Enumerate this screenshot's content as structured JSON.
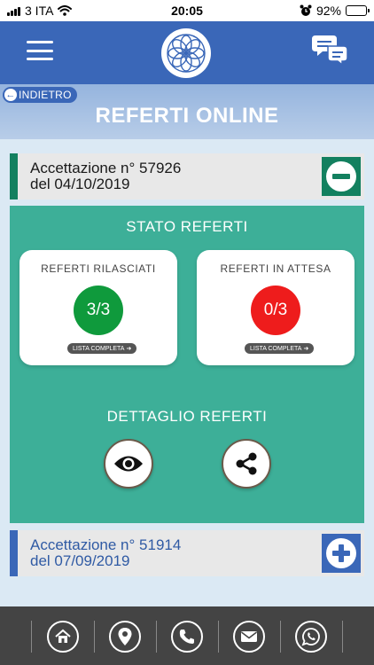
{
  "status_bar": {
    "carrier": "3 ITA",
    "time": "20:05",
    "battery": "92%",
    "battery_level": 0.92,
    "icons": [
      "signal-icon",
      "wifi-icon",
      "alarm-icon",
      "battery-icon"
    ]
  },
  "header": {
    "menu_icon": "hamburger-menu-icon",
    "logo_icon": "mandala-logo",
    "chat_icon": "chat-bubbles-icon"
  },
  "title_band": {
    "back_label": "INDIETRO",
    "title": "REFERTI ONLINE"
  },
  "accettazioni": [
    {
      "line1": "Accettazione n° 57926",
      "line2": "del 04/10/2019",
      "expanded": true,
      "toggle_icon": "minus-icon"
    },
    {
      "line1": "Accettazione n° 51914",
      "line2": "del 07/09/2019",
      "expanded": false,
      "toggle_icon": "plus-icon"
    }
  ],
  "stato": {
    "title": "STATO REFERTI",
    "rilasciati": {
      "label": "REFERTI RILASCIATI",
      "value": "3/3",
      "link": "LISTA COMPLETA"
    },
    "in_attesa": {
      "label": "REFERTI IN ATTESA",
      "value": "0/3",
      "link": "LISTA COMPLETA"
    }
  },
  "dettaglio": {
    "title": "DETTAGLIO REFERTI",
    "actions": [
      "eye-icon",
      "share-icon"
    ]
  },
  "bottom_nav": {
    "items": [
      "home-icon",
      "location-icon",
      "phone-icon",
      "mail-icon",
      "whatsapp-icon"
    ]
  },
  "colors": {
    "header_blue": "#3a67b8",
    "panel_green": "#3daf98",
    "dark_green": "#13805f",
    "status_green": "#0f9a3c",
    "status_red": "#ee1c1c",
    "bottom_bar": "#444444"
  }
}
